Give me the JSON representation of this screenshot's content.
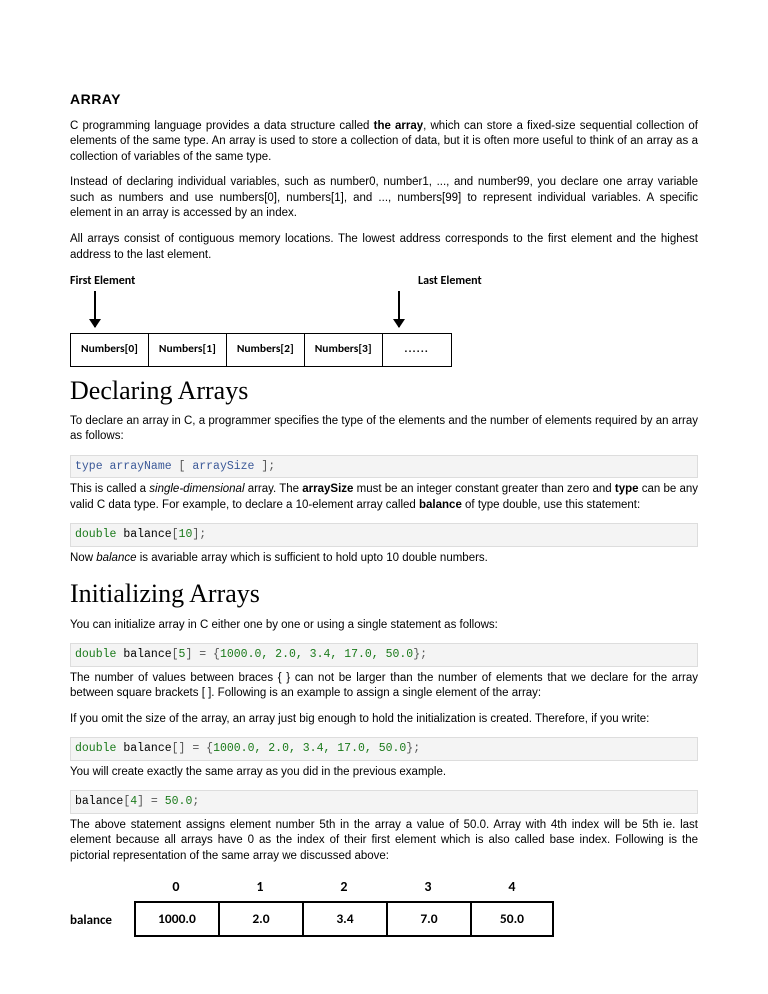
{
  "title": "ARRAY",
  "p1_a": "C programming language provides a data structure called ",
  "p1_bold": "the array",
  "p1_b": ", which can store a fixed-size sequential collection of elements of the same type. An array is used to store a collection of data, but it is often more useful to think of an array as a collection of variables of the same type.",
  "p2": "Instead of declaring individual variables, such as number0, number1, ..., and number99, you declare one array variable such as numbers and use numbers[0], numbers[1], and ..., numbers[99] to represent individual variables. A specific element in an array is accessed by an index.",
  "p3": "All arrays consist of contiguous memory locations. The lowest address corresponds to the first element and the highest address to the last element.",
  "diag1": {
    "first": "First Element",
    "last": "Last Element",
    "cells": [
      "Numbers[0]",
      "Numbers[1]",
      "Numbers[2]",
      "Numbers[3]",
      "......"
    ]
  },
  "h_declare": "Declaring Arrays",
  "p4": "To declare an array in C, a programmer specifies the type of the elements and the number of elements required by an array as follows:",
  "code1": {
    "a": "type arrayName ",
    "b": "[",
    "c": " arraySize ",
    "d": "];"
  },
  "p5_a": "This is called a ",
  "p5_em": "single-dimensional",
  "p5_b": " array. The ",
  "p5_bold1": "arraySize",
  "p5_c": " must be an integer constant greater than zero and ",
  "p5_bold2": "type",
  "p5_d": " can be any valid C data type. For example, to declare a 10-element array called ",
  "p5_bold3": "balance",
  "p5_e": " of type double, use this statement:",
  "code2": {
    "kw": "double",
    "sp": " balance",
    "b": "[",
    "n": "10",
    "e": "];"
  },
  "p6_a": "Now ",
  "p6_em": "balance",
  "p6_b": " is avariable array which is sufficient to hold upto 10 double numbers.",
  "h_init": "Initializing Arrays",
  "p7": "You can initialize array in C either one by one or using a single statement as follows:",
  "code3": {
    "kw": "double",
    "name": " balance",
    "b": "[",
    "n": "5",
    "mid": "] = {",
    "vals": "1000.0, 2.0, 3.4, 17.0, 50.0",
    "end": "};"
  },
  "p8": "The number of values between braces { } can not be larger than the number of elements that we declare for the array between square brackets [ ]. Following is an example to assign a single element of the array:",
  "p9": "If you omit the size of the array, an array just big enough to hold the initialization is created. Therefore, if you write:",
  "code4": {
    "kw": "double",
    "name": " balance",
    "b": "[] = {",
    "vals": "1000.0, 2.0, 3.4, 17.0, 50.0",
    "end": "};"
  },
  "p10": "You will create exactly the same array as you did in the previous example.",
  "code5": {
    "a": "balance",
    "b": "[",
    "n": "4",
    "c": "] = ",
    "v": "50.0",
    "e": ";"
  },
  "p11": "The above statement assigns element number 5th in the array a value of 50.0. Array with 4th index will be 5th ie. last element because all arrays have 0 as the index of their first element which is also called base index. Following is the pictorial representation of the same array we discussed above:",
  "diag2": {
    "label": "balance",
    "head": [
      "0",
      "1",
      "2",
      "3",
      "4"
    ],
    "row": [
      "1000.0",
      "2.0",
      "3.4",
      "7.0",
      "50.0"
    ]
  }
}
